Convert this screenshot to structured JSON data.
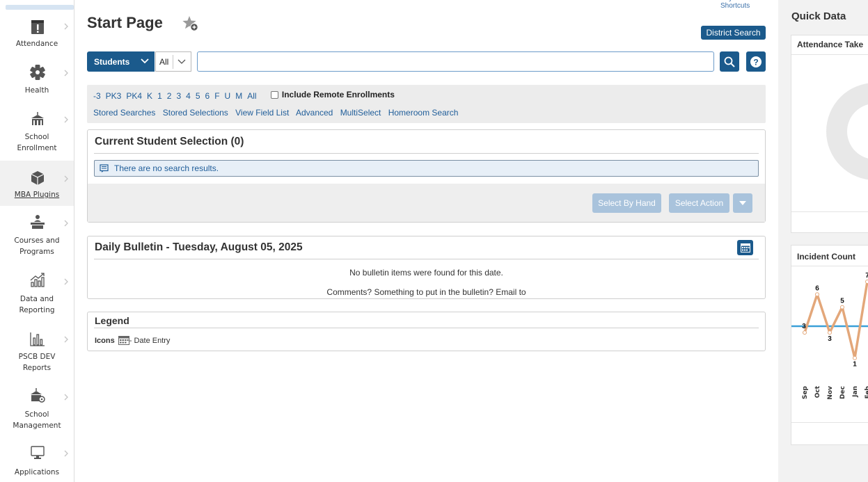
{
  "sidebar": {
    "items": [
      {
        "label": "Attendance",
        "icon": "attendance-icon"
      },
      {
        "label": "Health",
        "icon": "health-icon"
      },
      {
        "label": "School Enrollment",
        "icon": "school-enrollment-icon"
      },
      {
        "label": "MBA Plugins",
        "icon": "plugins-icon"
      },
      {
        "label": "Courses and Programs",
        "icon": "courses-icon"
      },
      {
        "label": "Data and Reporting",
        "icon": "data-reporting-icon"
      },
      {
        "label": "PSCB DEV Reports",
        "icon": "reports-icon"
      },
      {
        "label": "School Management",
        "icon": "school-management-icon"
      },
      {
        "label": "Applications",
        "icon": "applications-icon"
      }
    ]
  },
  "header": {
    "title": "Start Page",
    "keyboard_shortcuts": "Keyboard Shortcuts",
    "district_search": "District Search"
  },
  "search": {
    "type": "Students",
    "scope": "All",
    "value": "",
    "placeholder": ""
  },
  "filters": {
    "grades": [
      "-3",
      "PK3",
      "PK4",
      "K",
      "1",
      "2",
      "3",
      "4",
      "5",
      "6",
      "F",
      "U",
      "M",
      "All"
    ],
    "include_remote": "Include Remote Enrollments",
    "links": [
      "Stored Searches",
      "Stored Selections",
      "View Field List",
      "Advanced",
      "MultiSelect",
      "Homeroom Search"
    ]
  },
  "selection": {
    "title": "Current Student Selection (0)",
    "notice": "There are no search results.",
    "select_by_hand": "Select By Hand",
    "select_action": "Select Action"
  },
  "bulletin": {
    "title": "Daily Bulletin - Tuesday, August 05, 2025",
    "empty": "No bulletin items were found for this date.",
    "comments": "Comments? Something to put in the bulletin? Email to"
  },
  "legend": {
    "title": "Legend",
    "icons_label": "Icons",
    "date_entry": "- Date Entry"
  },
  "quick_data": {
    "title": "Quick Data",
    "attendance_title": "Attendance Take",
    "incident_title": "Incident Count"
  },
  "chart_data": {
    "type": "line",
    "categories": [
      "Sep",
      "Oct",
      "Nov",
      "Dec",
      "Jan",
      "Feb"
    ],
    "values": [
      3,
      6,
      3,
      5,
      1,
      7
    ],
    "data_labels": [
      "3",
      "6",
      "3",
      "5",
      "1",
      "7"
    ],
    "reference_value": 3.5,
    "ylim": [
      0,
      7
    ],
    "colors": {
      "line": "#e3a77a",
      "reference": "#3aa0d8"
    },
    "title": "Incident Count"
  }
}
